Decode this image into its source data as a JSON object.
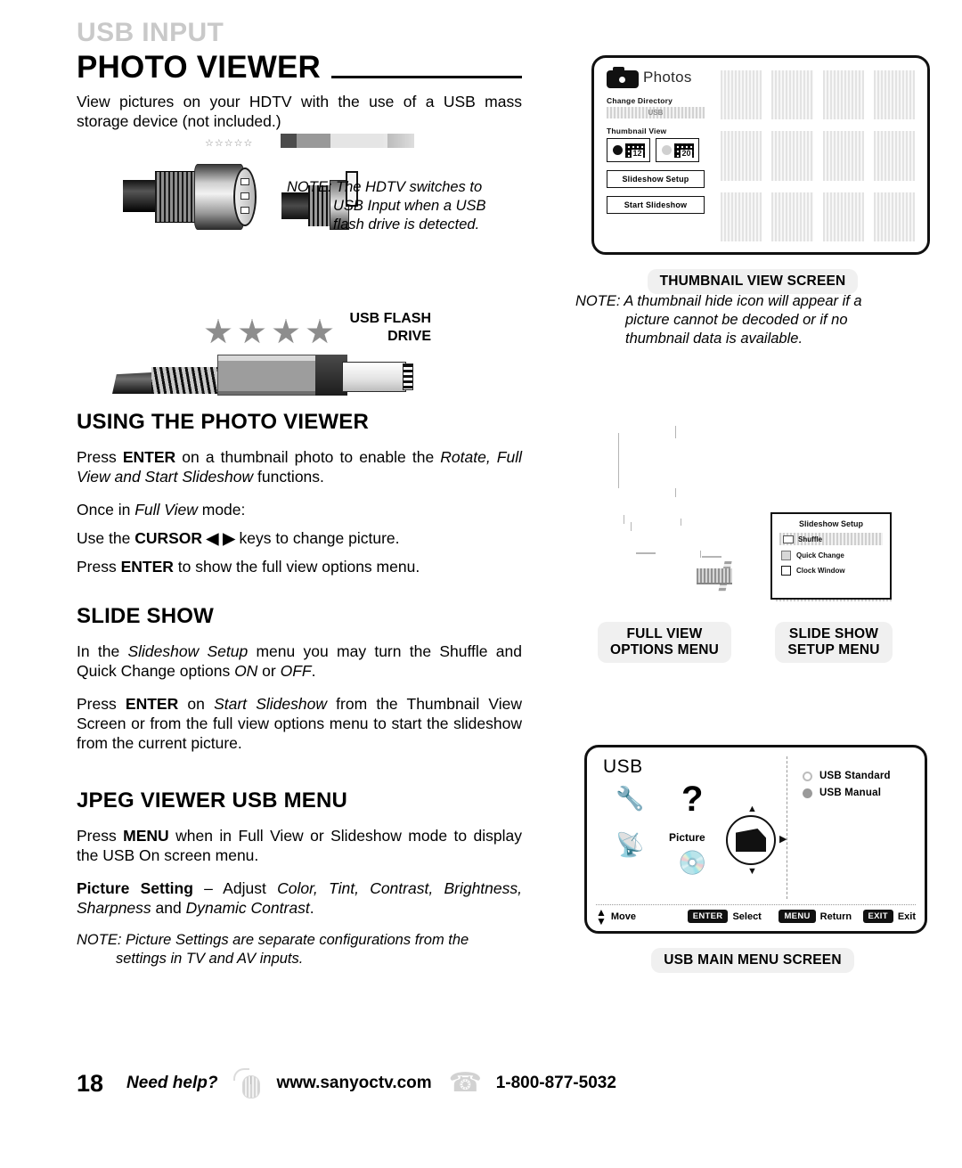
{
  "header": {
    "kicker": "USB INPUT",
    "title": "PHOTO VIEWER",
    "intro": "View pictures on your HDTV with the use of a USB mass storage device (not included.)"
  },
  "jack_note": {
    "label": "NOTE:",
    "line1": "The HDTV switches to",
    "line2": "USB Input when a USB",
    "line3": "flash drive is detected."
  },
  "flash_drive": {
    "label_line1": "USB FLASH",
    "label_line2": "DRIVE",
    "stars": "☆☆☆☆☆"
  },
  "sections": {
    "using": {
      "heading": "USING THE PHOTO VIEWER",
      "p1_a": "Press ",
      "p1_b": "ENTER",
      "p1_c": " on a thumbnail photo to enable the ",
      "p1_d": "Rotate, Full View and Start Slideshow",
      "p1_e": " functions.",
      "p2_a": "Once in ",
      "p2_b": "Full View",
      "p2_c": " mode:",
      "p3_a": "Use the ",
      "p3_b": "CURSOR",
      "p3_c": " ◀ ▶ ",
      "p3_d": "keys to change picture.",
      "p4_a": "Press ",
      "p4_b": "ENTER",
      "p4_c": " to show the full view options menu."
    },
    "slideshow": {
      "heading": "SLIDE SHOW",
      "p1_a": "In the ",
      "p1_b": "Slideshow Setup",
      "p1_c": " menu you may turn the Shuffle and Quick Change options ",
      "p1_d": "ON",
      "p1_e": " or ",
      "p1_f": "OFF",
      "p1_g": ".",
      "p2_a": "Press ",
      "p2_b": "ENTER",
      "p2_c": " on ",
      "p2_d": "Start Slideshow",
      "p2_e": " from the Thumbnail View Screen or from the full view options menu to start the slideshow from the current picture."
    },
    "jpeg": {
      "heading": "JPEG VIEWER USB MENU",
      "p1_a": "Press ",
      "p1_b": "MENU",
      "p1_c": " when in Full View or Slideshow mode to display the USB On screen menu.",
      "p2_a": "Picture Setting",
      "p2_b": " – Adjust ",
      "p2_c": "Color, Tint, Contrast, Brightness, Sharpness",
      "p2_d": " and ",
      "p2_e": "Dynamic Contrast",
      "p2_f": ".",
      "note_label": "NOTE:",
      "note_line1": " Picture Settings are separate configurations from the",
      "note_line2": "settings in TV and AV inputs."
    }
  },
  "thumbnail_screen": {
    "app_title": "Photos",
    "change_directory_label": "Change Directory",
    "change_directory_value": "USB",
    "thumbnail_view_label": "Thumbnail View",
    "view_12": "12",
    "view_20": "20",
    "slideshow_setup_button": "Slideshow Setup",
    "start_slideshow_button": "Start Slideshow",
    "caption": "THUMBNAIL VIEW SCREEN",
    "note_label": "NOTE:",
    "note_line1": " A thumbnail hide icon will appear if a",
    "note_line2": "picture cannot be decoded or if no",
    "note_line3": "thumbnail data is available."
  },
  "menus": {
    "fullview_caption_line1": "FULL VIEW",
    "fullview_caption_line2": "OPTIONS MENU",
    "slideshow_caption_line1": "SLIDE SHOW",
    "slideshow_caption_line2": "SETUP MENU",
    "slideshow_setup_title": "Slideshow Setup",
    "slideshow_row1": "Shuffle",
    "slideshow_row2": "Quick Change",
    "slideshow_row3": "Clock Window"
  },
  "usb_menu": {
    "title": "USB",
    "option1": "USB Standard",
    "option2": "USB Manual",
    "picture_label": "Picture",
    "question_mark": "?",
    "bottom_move": "Move",
    "bottom_enter_key": "ENTER",
    "bottom_enter_label": "Select",
    "bottom_menu_key": "MENU",
    "bottom_menu_label": "Return",
    "bottom_exit_key": "EXIT",
    "bottom_exit_label": "Exit",
    "caption": "USB MAIN MENU SCREEN"
  },
  "footer": {
    "page_number": "18",
    "need_help": "Need help?",
    "website": "www.sanyoctv.com",
    "phone": "1-800-877-5032"
  }
}
